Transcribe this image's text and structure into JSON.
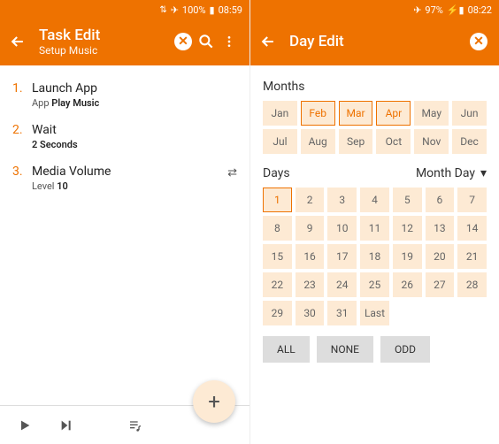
{
  "left": {
    "status": {
      "wifi": "⇅",
      "battery": "100%",
      "time": "08:59"
    },
    "header": {
      "title": "Task Edit",
      "subtitle": "Setup Music"
    },
    "tasks": [
      {
        "num": "1.",
        "name": "Launch App",
        "label": "App",
        "value": "Play Music",
        "swap": false
      },
      {
        "num": "2.",
        "name": "Wait",
        "label": "",
        "value": "2 Seconds",
        "swap": false
      },
      {
        "num": "3.",
        "name": "Media Volume",
        "label": "Level",
        "value": "10",
        "swap": true
      }
    ],
    "fab": "+"
  },
  "right": {
    "status": {
      "battery": "97%",
      "time": "08:22"
    },
    "header": {
      "title": "Day Edit"
    },
    "months_label": "Months",
    "months": [
      {
        "t": "Jan",
        "sel": false
      },
      {
        "t": "Feb",
        "sel": true
      },
      {
        "t": "Mar",
        "sel": true
      },
      {
        "t": "Apr",
        "sel": true
      },
      {
        "t": "May",
        "sel": false
      },
      {
        "t": "Jun",
        "sel": false
      },
      {
        "t": "Jul",
        "sel": false
      },
      {
        "t": "Aug",
        "sel": false
      },
      {
        "t": "Sep",
        "sel": false
      },
      {
        "t": "Oct",
        "sel": false
      },
      {
        "t": "Nov",
        "sel": false
      },
      {
        "t": "Dec",
        "sel": false
      }
    ],
    "days_label": "Days",
    "days_mode": "Month Day",
    "days": [
      {
        "t": "1",
        "sel": true
      },
      {
        "t": "2"
      },
      {
        "t": "3"
      },
      {
        "t": "4"
      },
      {
        "t": "5"
      },
      {
        "t": "6"
      },
      {
        "t": "7"
      },
      {
        "t": "8"
      },
      {
        "t": "9"
      },
      {
        "t": "10"
      },
      {
        "t": "11"
      },
      {
        "t": "12"
      },
      {
        "t": "13"
      },
      {
        "t": "14"
      },
      {
        "t": "15"
      },
      {
        "t": "16"
      },
      {
        "t": "17"
      },
      {
        "t": "18"
      },
      {
        "t": "19"
      },
      {
        "t": "20"
      },
      {
        "t": "21"
      },
      {
        "t": "22"
      },
      {
        "t": "23"
      },
      {
        "t": "24"
      },
      {
        "t": "25"
      },
      {
        "t": "26"
      },
      {
        "t": "27"
      },
      {
        "t": "28"
      },
      {
        "t": "29"
      },
      {
        "t": "30"
      },
      {
        "t": "31"
      },
      {
        "t": "Last"
      }
    ],
    "buttons": {
      "all": "ALL",
      "none": "NONE",
      "odd": "ODD"
    }
  }
}
